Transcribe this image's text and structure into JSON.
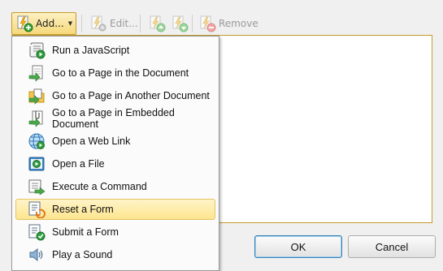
{
  "toolbar": {
    "add_label": "Add...",
    "edit_label": "Edit...",
    "remove_label": "Remove"
  },
  "menu": {
    "items": [
      {
        "label": "Run a JavaScript",
        "icon": "javascript-scroll-icon"
      },
      {
        "label": "Go to a Page in the Document",
        "icon": "goto-page-icon"
      },
      {
        "label": "Go to a Page in Another Document",
        "icon": "goto-other-document-icon"
      },
      {
        "label": "Go to a Page in Embedded Document",
        "icon": "goto-embedded-document-icon"
      },
      {
        "label": "Open a Web Link",
        "icon": "globe-icon"
      },
      {
        "label": "Open a File",
        "icon": "open-file-icon"
      },
      {
        "label": "Execute a Command",
        "icon": "execute-command-icon"
      },
      {
        "label": "Reset a Form",
        "icon": "reset-form-icon"
      },
      {
        "label": "Submit a Form",
        "icon": "submit-form-icon"
      },
      {
        "label": "Play a Sound",
        "icon": "speaker-icon"
      }
    ],
    "highlighted_index": 7
  },
  "buttons": {
    "ok_label": "OK",
    "cancel_label": "Cancel"
  },
  "colors": {
    "highlight": "#fde58f",
    "highlight_border": "#e5c365",
    "list_border": "#c39a2c"
  }
}
